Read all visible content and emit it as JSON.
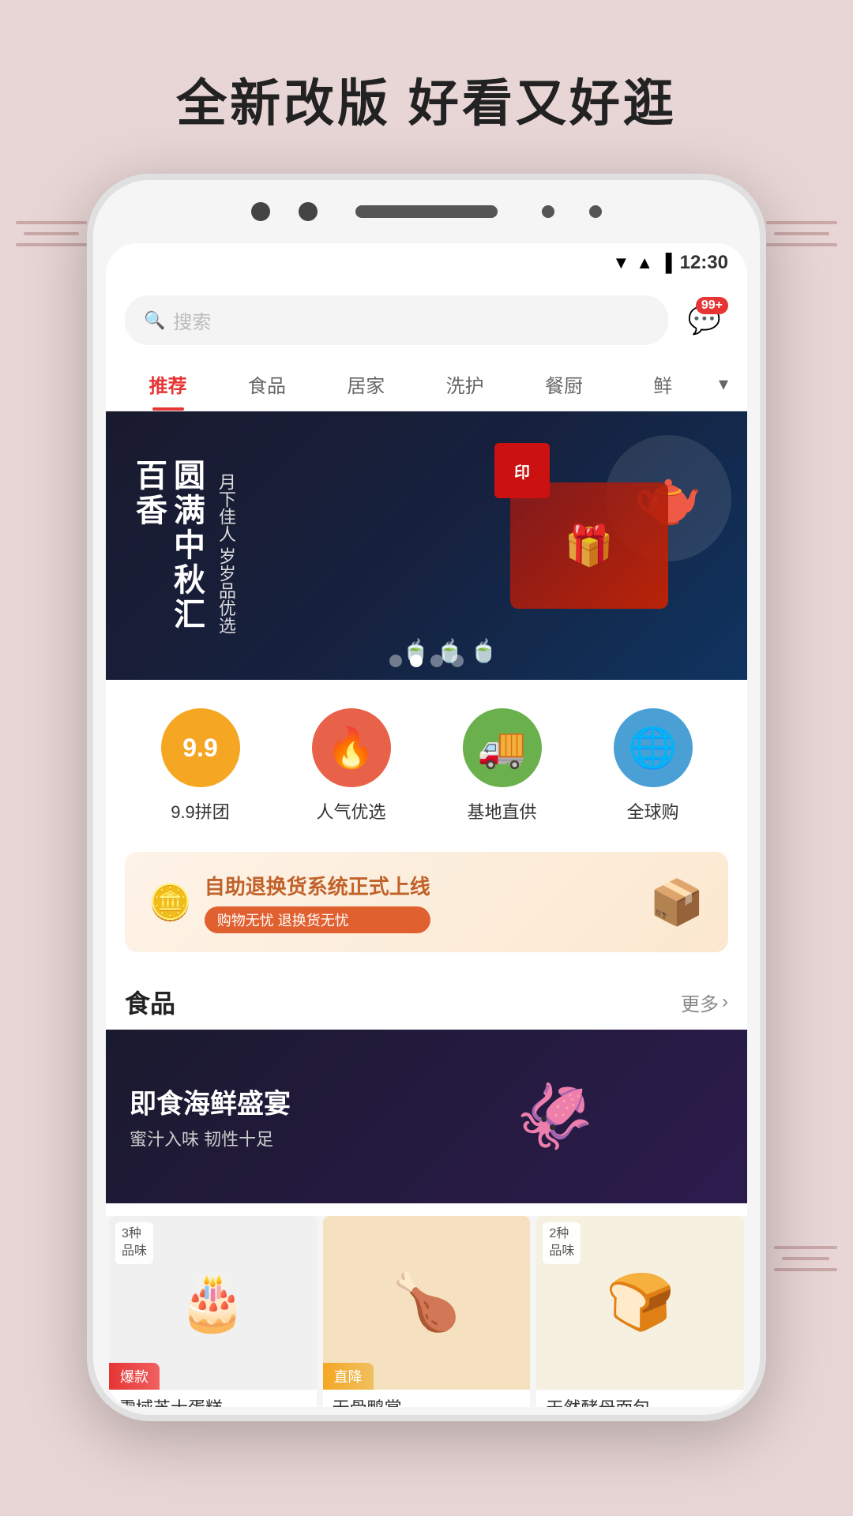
{
  "page": {
    "title": "全新改版 好看又好逛",
    "bg_color": "#e8d5d5"
  },
  "status_bar": {
    "time": "12:30",
    "wifi": "▼",
    "signal": "▲",
    "battery": "🔋"
  },
  "search": {
    "placeholder": "搜索",
    "icon": "🔍"
  },
  "message_button": {
    "icon": "💬",
    "badge": "99+"
  },
  "nav_tabs": [
    {
      "label": "推荐",
      "active": true
    },
    {
      "label": "食品",
      "active": false
    },
    {
      "label": "居家",
      "active": false
    },
    {
      "label": "洗护",
      "active": false
    },
    {
      "label": "餐厨",
      "active": false
    },
    {
      "label": "鲜",
      "active": false
    }
  ],
  "banner": {
    "title": "圆满中秋汇百香",
    "subtitle1": "月下佳人",
    "subtitle2": "岁岁品优选",
    "dots": [
      false,
      false,
      true,
      false
    ]
  },
  "features": [
    {
      "label": "9.9拼团",
      "icon": "9.9",
      "color": "orange"
    },
    {
      "label": "人气优选",
      "icon": "🔥",
      "color": "coral"
    },
    {
      "label": "基地直供",
      "icon": "🚚",
      "color": "green"
    },
    {
      "label": "全球购",
      "icon": "🌐",
      "color": "blue"
    }
  ],
  "promo": {
    "title": "自助退换货系统正式上线",
    "subtitle": "购物无忧 退换货无忧",
    "left_icon": "🪙",
    "right_icon": "📦"
  },
  "food_section": {
    "title": "食品",
    "more": "更多",
    "banner_title": "即食海鲜盛宴",
    "banner_sub": "蜜汁入味 韧性十足"
  },
  "products": [
    {
      "name": "雪域芝士蛋糕",
      "tag": "爆款",
      "tag_color": "red",
      "icon": "🎂",
      "variants": "3种\n品味"
    },
    {
      "name": "无骨鸭掌",
      "tag": "直降",
      "tag_color": "yellow",
      "icon": "🍗",
      "variants": null
    },
    {
      "name": "天然酵母面包",
      "tag": null,
      "tag_color": null,
      "icon": "🍞",
      "variants": "2种\n品味"
    }
  ]
}
